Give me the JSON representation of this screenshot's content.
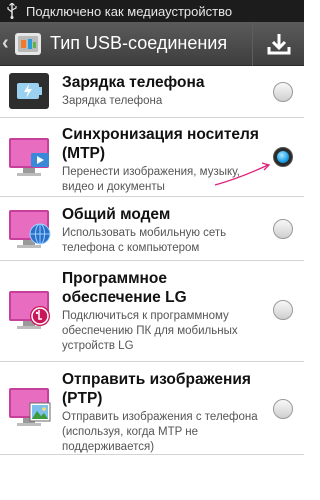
{
  "status_bar": {
    "text": "Подключено как медиаустройство"
  },
  "action_bar": {
    "title": "Тип USB-соединения"
  },
  "items": [
    {
      "name": "Зарядка телефона",
      "desc": "Зарядка телефона",
      "checked": false
    },
    {
      "name": "Синхронизация носителя (MTP)",
      "desc": "Перенести изображения, музыку, видео и документы",
      "checked": true
    },
    {
      "name": "Общий модем",
      "desc": "Использовать мобильную сеть телефона с компьютером",
      "checked": false
    },
    {
      "name": "Программное обеспечение LG",
      "desc": "Подключиться к программному обеспечению ПК для мобильных устройств LG",
      "checked": false
    },
    {
      "name": "Отправить изображения (PTP)",
      "desc": "Отправить изображения с телефона (используя, когда MTP не поддерживается)",
      "checked": false
    }
  ],
  "colors": {
    "accent": "#1aa0e8",
    "annotation": "#e0207a"
  }
}
